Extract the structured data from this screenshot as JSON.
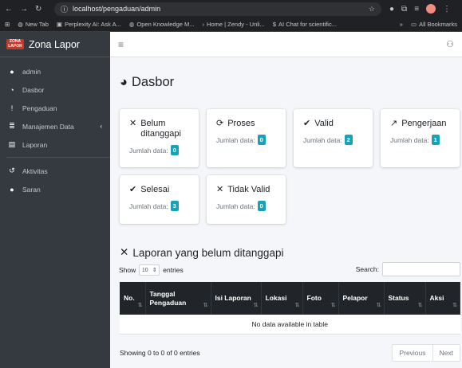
{
  "browser": {
    "url": "localhost/pengaduan/admin",
    "bookmarks": [
      "New Tab",
      "Perplexity AI: Ask A...",
      "Open Knowledge M...",
      "Home | Zendy - Unli...",
      "AI Chat for scientific..."
    ],
    "bookmarks_more": "»",
    "all_bookmarks": "All Bookmarks"
  },
  "sidebar": {
    "brand_logo": "ZONA LAPOR",
    "brand": "Zona Lapor",
    "items": [
      {
        "label": "admin",
        "icon": "user-icon"
      },
      {
        "label": "Dasbor",
        "icon": "dashboard-icon"
      },
      {
        "label": "Pengaduan",
        "icon": "exclamation-icon"
      },
      {
        "label": "Manajemen Data",
        "icon": "list-icon"
      },
      {
        "label": "Laporan",
        "icon": "file-icon"
      },
      {
        "label": "Aktivitas",
        "icon": "history-icon"
      },
      {
        "label": "Saran",
        "icon": "lightbulb-icon"
      }
    ]
  },
  "page_title": "Dasbor",
  "cards": [
    {
      "title": "Belum ditanggapi",
      "icon": "x-icon",
      "label": "Jumlah data:",
      "count": "0"
    },
    {
      "title": "Proses",
      "icon": "sync-icon",
      "label": "Jumlah data:",
      "count": "0"
    },
    {
      "title": "Valid",
      "icon": "check-icon",
      "label": "Jumlah data:",
      "count": "2"
    },
    {
      "title": "Pengerjaan",
      "icon": "trend-icon",
      "label": "Jumlah data:",
      "count": "1"
    },
    {
      "title": "Selesai",
      "icon": "double-check-icon",
      "label": "Jumlah data:",
      "count": "3"
    },
    {
      "title": "Tidak Valid",
      "icon": "x-icon",
      "label": "Jumlah data:",
      "count": "0"
    }
  ],
  "table_section": {
    "title": "Laporan yang belum ditanggapi",
    "show_label": "Show",
    "show_value": "10",
    "entries_label": "entries",
    "search_label": "Search:",
    "columns": [
      "No.",
      "Tanggal Pengaduan",
      "Isi Laporan",
      "Lokasi",
      "Foto",
      "Pelapor",
      "Status",
      "Aksi"
    ],
    "empty": "No data available in table",
    "info": "Showing 0 to 0 of 0 entries",
    "prev": "Previous",
    "next": "Next"
  }
}
